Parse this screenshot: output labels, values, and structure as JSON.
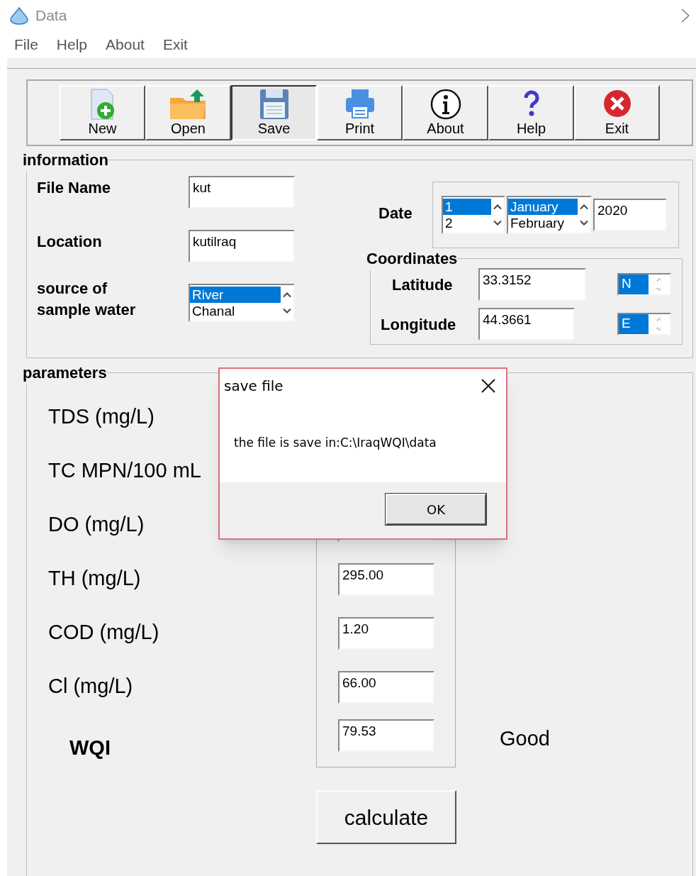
{
  "window": {
    "title": "Data"
  },
  "menu": [
    "File",
    "Help",
    "About",
    "Exit"
  ],
  "toolbar": [
    {
      "label": "New",
      "kind": "new",
      "selected": false
    },
    {
      "label": "Open",
      "kind": "open",
      "selected": false
    },
    {
      "label": "Save",
      "kind": "save",
      "selected": true
    },
    {
      "label": "Print",
      "kind": "print",
      "selected": false
    },
    {
      "label": "About",
      "kind": "about",
      "selected": false
    },
    {
      "label": "Help",
      "kind": "help",
      "selected": false
    },
    {
      "label": "Exit",
      "kind": "exit",
      "selected": false
    }
  ],
  "information": {
    "title": "information",
    "file_name": {
      "label": "File Name",
      "value": "kut"
    },
    "location": {
      "label": "Location",
      "value": "kutilraq"
    },
    "source": {
      "label": "source of sample water",
      "items": [
        {
          "label": "River",
          "selected": true
        },
        {
          "label": "Chanal",
          "selected": false
        }
      ]
    },
    "date": {
      "label": "Date",
      "days": [
        {
          "label": "1",
          "selected": true
        },
        {
          "label": "2",
          "selected": false
        }
      ],
      "months": [
        {
          "label": "January",
          "selected": true
        },
        {
          "label": "February",
          "selected": false
        }
      ],
      "year": "2020"
    },
    "coordinates": {
      "title": "Coordinates",
      "latitude": {
        "label": "Latitude",
        "value": "33.3152",
        "direction": "N"
      },
      "longitude": {
        "label": "Longitude",
        "value": "44.3661",
        "direction": "E"
      }
    }
  },
  "parameters": {
    "title": "parameters",
    "rows": [
      {
        "label": "TDS (mg/L)"
      },
      {
        "label": "TC MPN/100 mL"
      },
      {
        "label": "DO (mg/L)"
      },
      {
        "label": "TH (mg/L)",
        "value": "295.00"
      },
      {
        "label": "COD (mg/L)",
        "value": "1.20"
      },
      {
        "label": "Cl (mg/L)",
        "value": "66.00"
      }
    ],
    "wqi": {
      "label": "WQI",
      "value": "79.53",
      "rating": "Good"
    },
    "calculate": "calculate"
  },
  "dialog": {
    "title": "save file",
    "message": "the file is save in:C:\\IraqWQI\\data",
    "ok": "OK"
  }
}
